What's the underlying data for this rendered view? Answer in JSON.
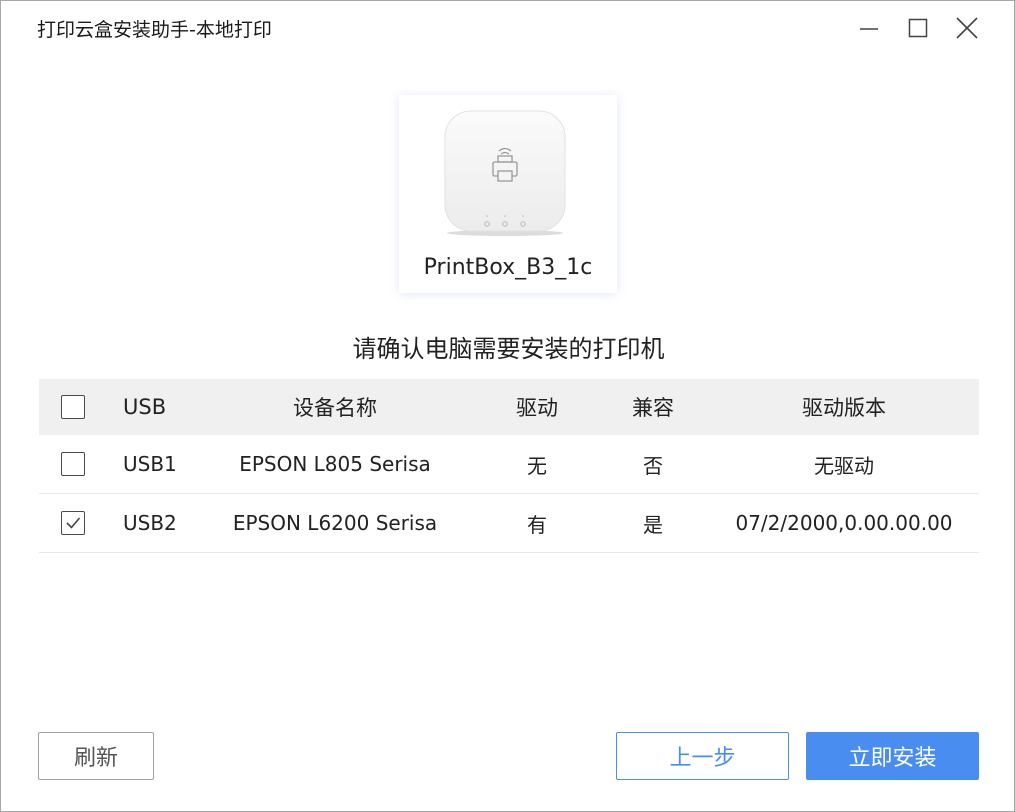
{
  "window": {
    "title": "打印云盒安装助手-本地打印"
  },
  "device": {
    "name": "PrintBox_B3_1c"
  },
  "prompt": "请确认电脑需要安装的打印机",
  "table": {
    "headers": {
      "usb": "USB",
      "name": "设备名称",
      "driver": "驱动",
      "compatible": "兼容",
      "driver_version": "驱动版本"
    },
    "select_all_checked": false,
    "rows": [
      {
        "checked": false,
        "usb": "USB1",
        "name": "EPSON L805 Serisa",
        "driver": "无",
        "compatible": "否",
        "driver_version": "无驱动"
      },
      {
        "checked": true,
        "usb": "USB2",
        "name": "EPSON L6200 Serisa",
        "driver": "有",
        "compatible": "是",
        "driver_version": "07/2/2000,0.00.00.00"
      }
    ]
  },
  "buttons": {
    "refresh": "刷新",
    "back": "上一步",
    "install": "立即安装"
  },
  "colors": {
    "accent": "#4a8df0",
    "header_bg": "#f0f0f0"
  }
}
